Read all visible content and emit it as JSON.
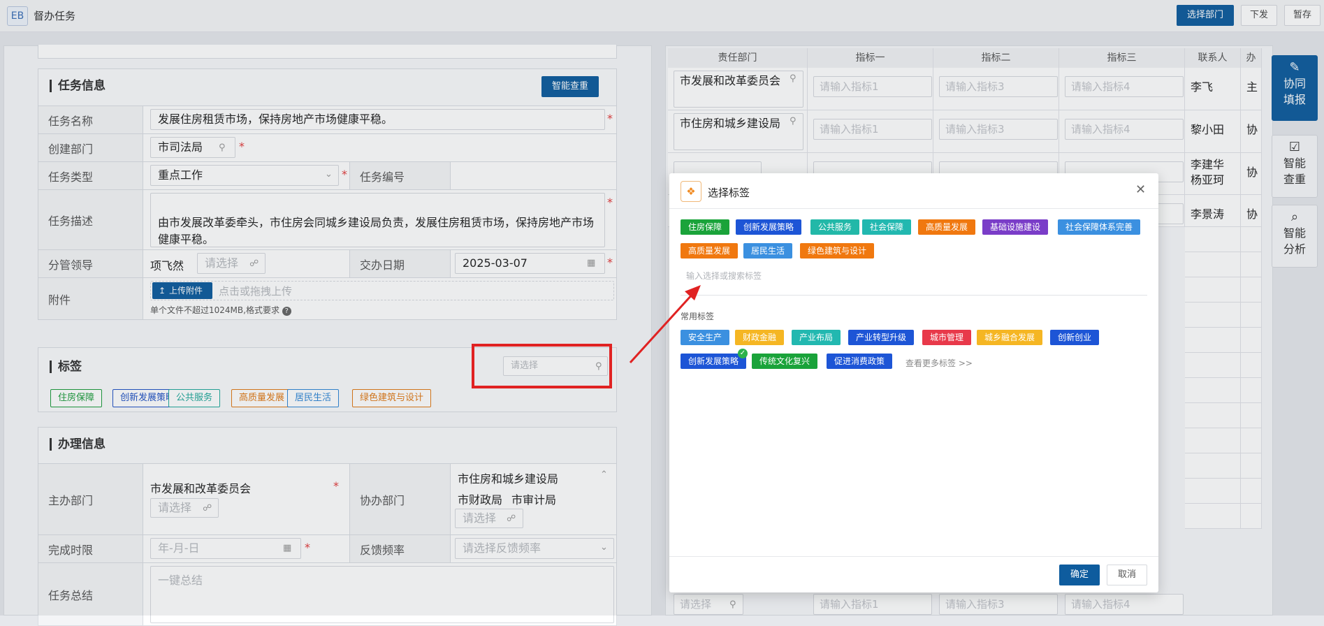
{
  "app": {
    "logo": "EB",
    "title": "督办任务"
  },
  "toolbar": {
    "select_dept": "选择部门",
    "issue": "下发",
    "draft": "暂存"
  },
  "task_info": {
    "section_title": "任务信息",
    "smart_check": "智能查重",
    "name_label": "任务名称",
    "name_value": "发展住房租赁市场，保持房地产市场健康平稳。",
    "creator_label": "创建部门",
    "creator_value": "市司法局",
    "type_label": "任务类型",
    "type_value": "重点工作",
    "number_label": "任务编号",
    "desc_label": "任务描述",
    "desc_value": "由市发展改革委牵头，市住房会同城乡建设局负责，发展住房租赁市场，保持房地产市场健康平稳。",
    "leader_label": "分管领导",
    "leader_value": "项飞然",
    "leader_placeholder": "请选择",
    "date_label": "交办日期",
    "date_value": "2025-03-07",
    "attach_label": "附件",
    "upload_button": "上传附件",
    "upload_hint": "点击或拖拽上传",
    "upload_limit": "单个文件不超过1024MB,格式要求"
  },
  "tags_section": {
    "title": "标签",
    "select_placeholder": "请选择",
    "tags": [
      {
        "label": "住房保障",
        "color": "#1a9b3a"
      },
      {
        "label": "创新发展策略",
        "color": "#2052c4"
      },
      {
        "label": "公共服务",
        "color": "#21a99b"
      },
      {
        "label": "高质量发展",
        "color": "#e07a16"
      },
      {
        "label": "居民生活",
        "color": "#2f86d6"
      },
      {
        "label": "绿色建筑与设计",
        "color": "#e07a16"
      }
    ]
  },
  "handling": {
    "section_title": "办理信息",
    "lead_label": "主办部门",
    "lead_value": "市发展和改革委员会",
    "lead_placeholder": "请选择",
    "assist_label": "协办部门",
    "assist_line1": "市住房和城乡建设局",
    "assist_line2a": "市财政局",
    "assist_line2b": "市审计局",
    "assist_placeholder": "请选择",
    "deadline_label": "完成时限",
    "deadline_placeholder": "年-月-日",
    "freq_label": "反馈频率",
    "freq_placeholder": "请选择反馈频率",
    "summary_label": "任务总结",
    "summary_placeholder": "一键总结"
  },
  "resp_table": {
    "headers": [
      "责任部门",
      "指标一",
      "指标二",
      "指标三",
      "联系人",
      "办"
    ],
    "rows": [
      {
        "dept": "市发展和改革委员会",
        "p1": "请输入指标1",
        "p2": "请输入指标3",
        "p3": "请输入指标4",
        "contact": "李飞",
        "role": "主"
      },
      {
        "dept": "市住房和城乡建设局",
        "p1": "请输入指标1",
        "p2": "请输入指标3",
        "p3": "请输入指标4",
        "contact": "黎小田",
        "role": "协"
      },
      {
        "dept": "",
        "p1": "",
        "p2": "",
        "p3": "",
        "contact": "李建华\n杨亚珂",
        "role": "协"
      },
      {
        "dept": "",
        "p1": "",
        "p2": "",
        "p3": "",
        "contact": "李景涛",
        "role": "协"
      }
    ],
    "last_row": {
      "dept_placeholder": "请选择",
      "p1": "请输入指标1",
      "p2": "请输入指标3",
      "p3": "请输入指标4"
    }
  },
  "side_tools": [
    {
      "label": "协同填报",
      "icon": "edit-icon"
    },
    {
      "label": "智能查重",
      "icon": "check-icon"
    },
    {
      "label": "智能分析",
      "icon": "analysis-icon"
    }
  ],
  "modal": {
    "title": "选择标签",
    "selected_tags": [
      {
        "label": "住房保障",
        "color": "#1aa33a"
      },
      {
        "label": "创新发展策略",
        "color": "#1d55d6"
      },
      {
        "label": "公共服务",
        "color": "#22b8a8"
      },
      {
        "label": "社会保障",
        "color": "#22b8b0"
      },
      {
        "label": "高质量发展",
        "color": "#f0780f"
      },
      {
        "label": "基础设施建设",
        "color": "#7a3dc8"
      },
      {
        "label": "社会保障体系完善",
        "color": "#3b90e0"
      },
      {
        "label": "高质量发展",
        "color": "#f0780f"
      },
      {
        "label": "居民生活",
        "color": "#3b90e0"
      },
      {
        "label": "绿色建筑与设计",
        "color": "#f0780f"
      }
    ],
    "search_placeholder": "输入选择或搜索标签",
    "common_title": "常用标签",
    "common_tags": [
      {
        "label": "安全生产",
        "color": "#3b90e0"
      },
      {
        "label": "财政金融",
        "color": "#f5b623"
      },
      {
        "label": "产业布局",
        "color": "#22b8b0"
      },
      {
        "label": "产业转型升级",
        "color": "#1d55d6"
      },
      {
        "label": "城市管理",
        "color": "#e8394a"
      },
      {
        "label": "城乡融合发展",
        "color": "#f5b623"
      },
      {
        "label": "创新创业",
        "color": "#1d55d6"
      },
      {
        "label": "创新发展策略",
        "color": "#1d55d6"
      },
      {
        "label": "传统文化复兴",
        "color": "#1aa33a"
      },
      {
        "label": "促进消费政策",
        "color": "#1d55d6"
      }
    ],
    "more_link": "查看更多标签 >>",
    "confirm": "确定",
    "cancel": "取消"
  }
}
